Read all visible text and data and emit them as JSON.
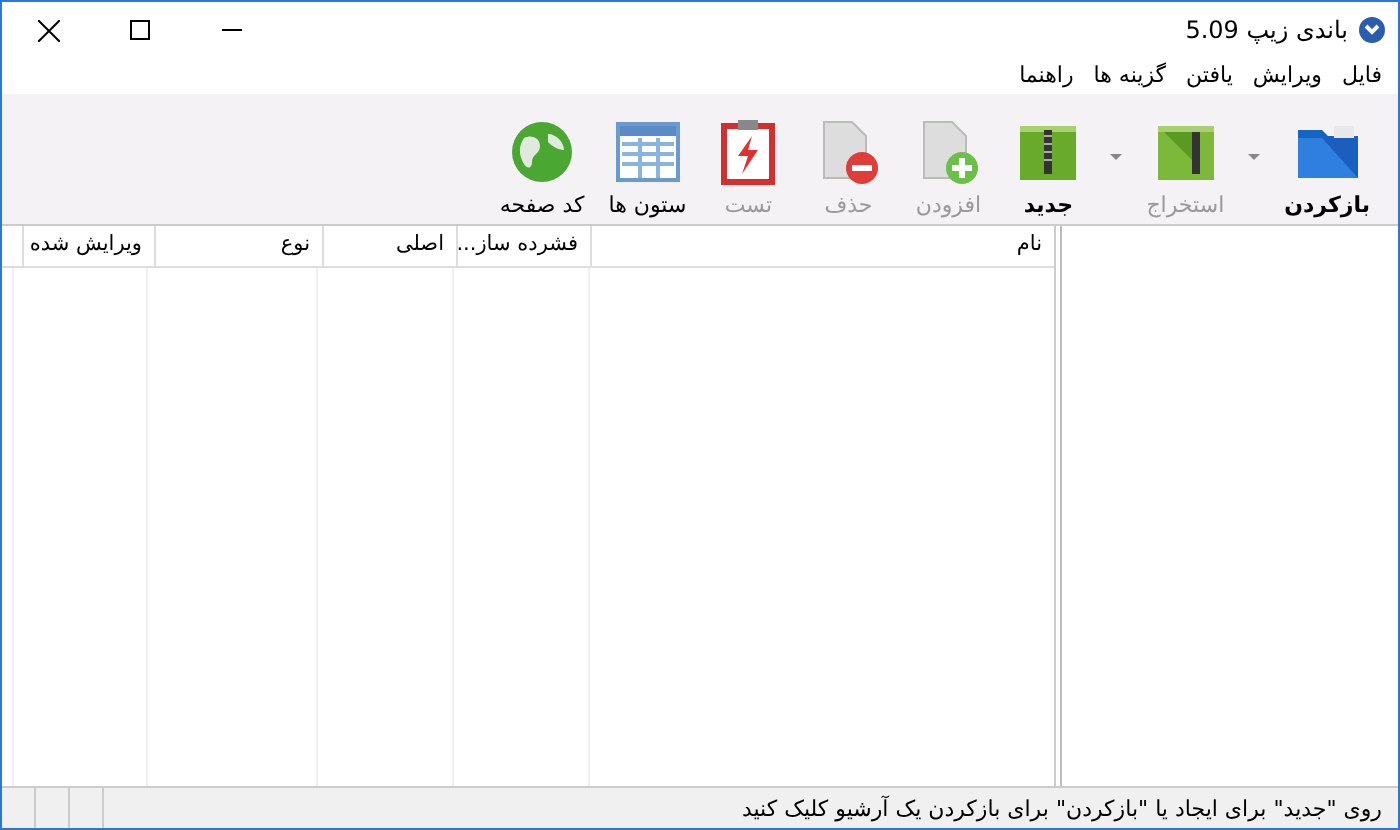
{
  "window": {
    "title": "باندی زیپ 5.09"
  },
  "menu": [
    {
      "label": "فایل"
    },
    {
      "label": "ویرایش"
    },
    {
      "label": "یافتن"
    },
    {
      "label": "گزینه ها"
    },
    {
      "label": "راهنما"
    }
  ],
  "toolbar": [
    {
      "kind": "folder",
      "label": "بازکردن",
      "disabled": false,
      "bold": true,
      "dropdown": true
    },
    {
      "kind": "extract",
      "label": "استخراج",
      "disabled": true,
      "bold": false,
      "dropdown": true
    },
    {
      "kind": "archive",
      "label": "جدید",
      "disabled": false,
      "bold": true,
      "dropdown": false
    },
    {
      "kind": "add",
      "label": "افزودن",
      "disabled": true,
      "bold": false,
      "dropdown": false
    },
    {
      "kind": "delete",
      "label": "حذف",
      "disabled": true,
      "bold": false,
      "dropdown": false
    },
    {
      "kind": "test",
      "label": "تست",
      "disabled": true,
      "bold": false,
      "dropdown": false
    },
    {
      "kind": "columns",
      "label": "ستون ها",
      "disabled": false,
      "bold": false,
      "dropdown": false
    },
    {
      "kind": "globe",
      "label": "کد صفحه",
      "disabled": false,
      "bold": false,
      "dropdown": false
    }
  ],
  "table": {
    "columns": [
      "نام",
      "فشرده ساز...",
      "اصلی",
      "نوع",
      "ویرایش شده"
    ]
  },
  "status_bar": {
    "text": "روی \"جدید\" برای ایجاد یا \"بازکردن\" برای بازکردن یک آرشیو کلیک کنید"
  }
}
